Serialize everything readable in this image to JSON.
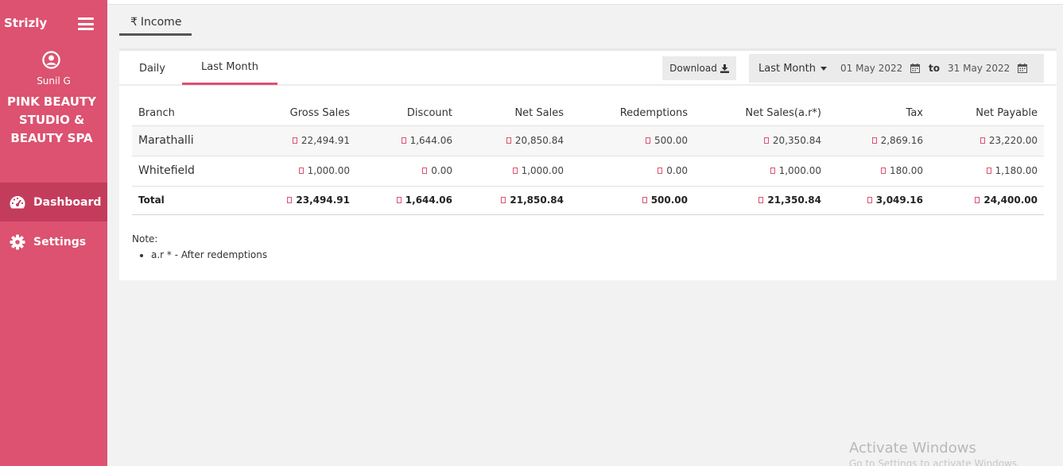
{
  "sidebar": {
    "brand": "Strizly",
    "user_name": "Sunil G",
    "salon_name": "PINK BEAUTY STUDIO & BEAUTY SPA",
    "nav": [
      {
        "label": "Dashboard",
        "icon": "dashboard-icon",
        "active": true
      },
      {
        "label": "Settings",
        "icon": "gear-icon",
        "active": false
      }
    ]
  },
  "income_tab": {
    "symbol": "₹",
    "label": "Income"
  },
  "subtabs": [
    {
      "label": "Daily",
      "active": false
    },
    {
      "label": "Last Month",
      "active": true
    }
  ],
  "toolbar": {
    "download_label": "Download",
    "range_label": "Last Month",
    "date_from": "01 May 2022",
    "to_word": "to",
    "date_to": "31 May 2022"
  },
  "table": {
    "headers": [
      "Branch",
      "Gross Sales",
      "Discount",
      "Net Sales",
      "Redemptions",
      "Net Sales(a.r*)",
      "Tax",
      "Net Payable"
    ],
    "rows": [
      {
        "branch": "Marathalli",
        "gross_sales": "22,494.91",
        "discount": "1,644.06",
        "net_sales": "20,850.84",
        "redemptions": "500.00",
        "net_sales_ar": "20,350.84",
        "tax": "2,869.16",
        "net_payable": "23,220.00"
      },
      {
        "branch": "Whitefield",
        "gross_sales": "1,000.00",
        "discount": "0.00",
        "net_sales": "1,000.00",
        "redemptions": "0.00",
        "net_sales_ar": "1,000.00",
        "tax": "180.00",
        "net_payable": "1,180.00"
      }
    ],
    "total": {
      "label": "Total",
      "gross_sales": "23,494.91",
      "discount": "1,644.06",
      "net_sales": "21,850.84",
      "redemptions": "500.00",
      "net_sales_ar": "21,350.84",
      "tax": "3,049.16",
      "net_payable": "24,400.00"
    }
  },
  "note": {
    "title": "Note:",
    "items": [
      "a.r * - After redemptions"
    ]
  },
  "watermark": {
    "title": "Activate Windows",
    "subtitle": "Go to Settings to activate Windows."
  },
  "colors": {
    "sidebar": "#dc5270",
    "sidebar_active": "#c43c5c",
    "accent": "#dc5270"
  }
}
